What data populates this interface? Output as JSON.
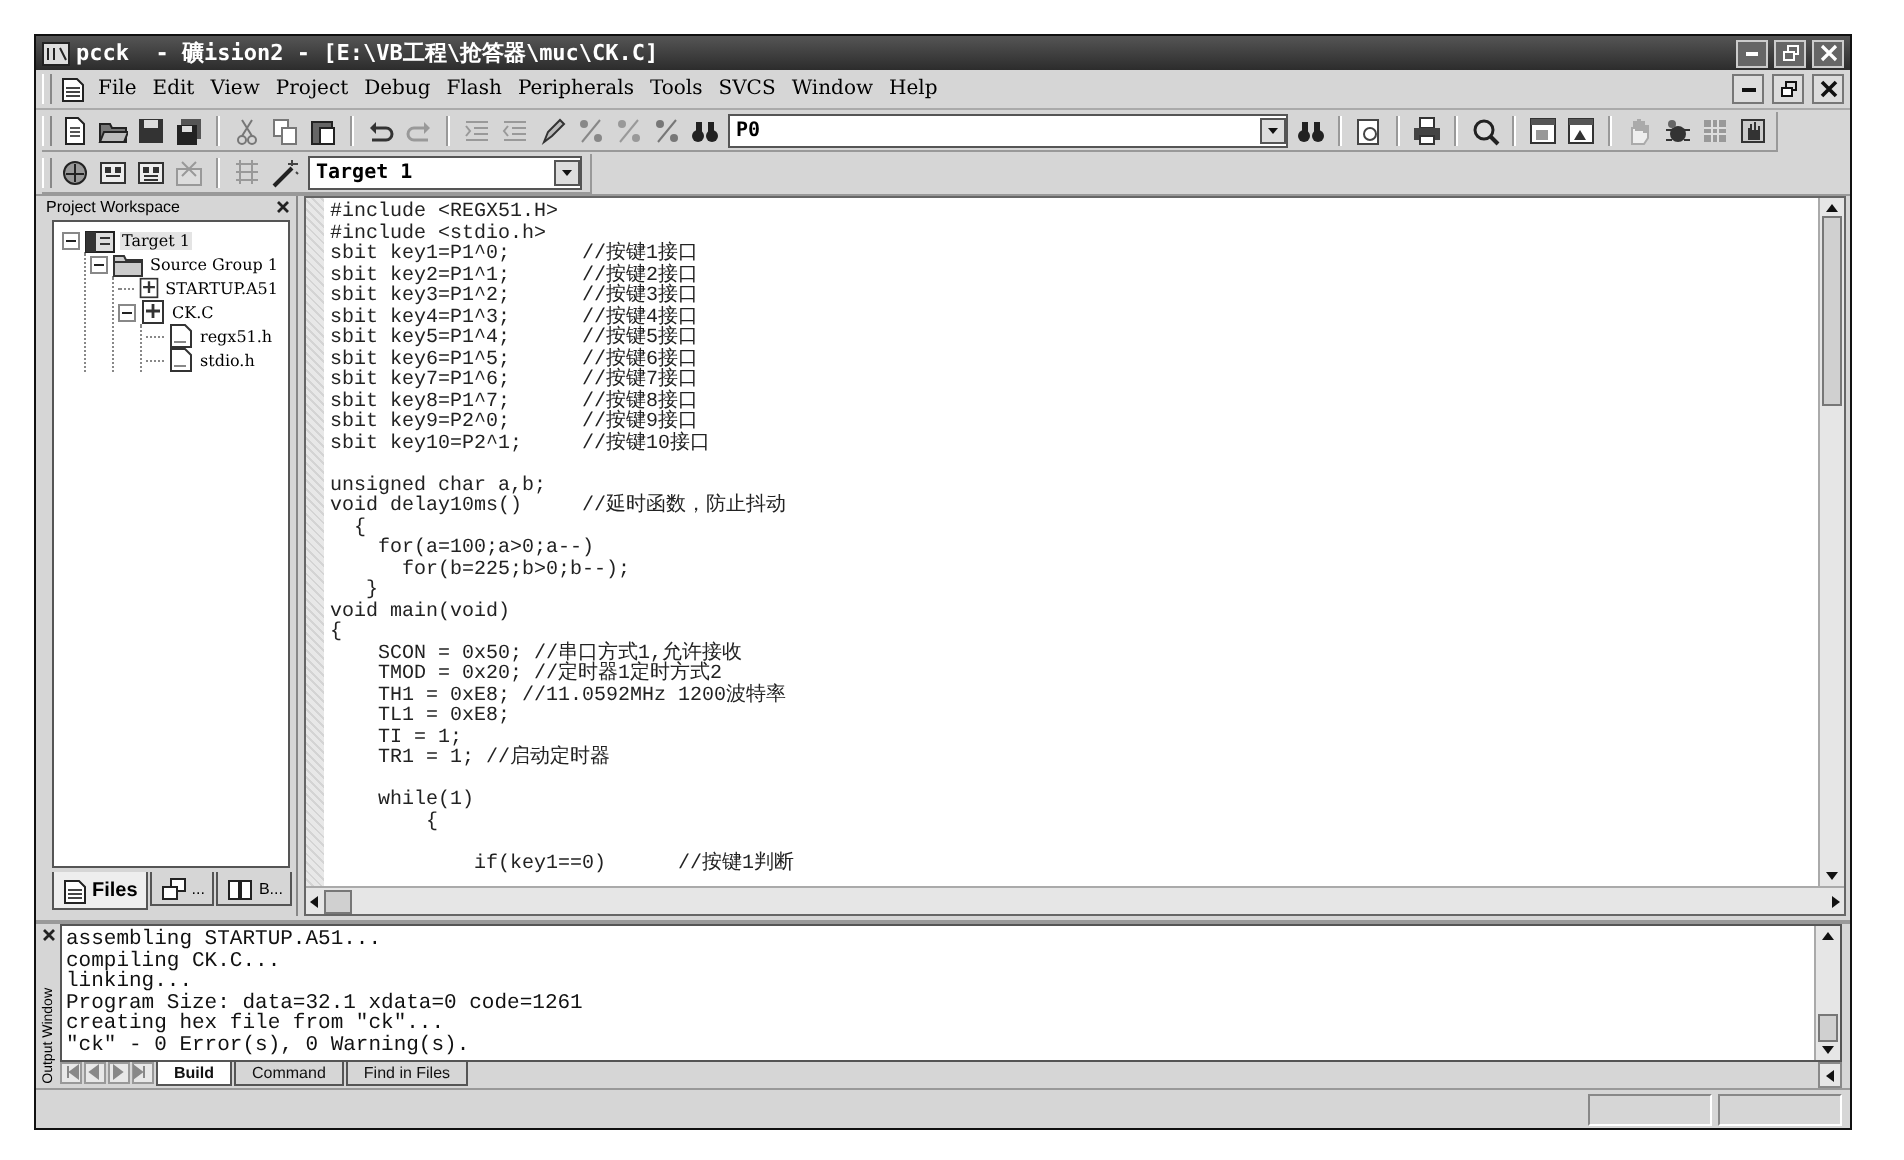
{
  "window": {
    "title": "pcck  - 礦ision2 - [E:\\VB工程\\抢答器\\muc\\CK.C]"
  },
  "menu": [
    "File",
    "Edit",
    "View",
    "Project",
    "Debug",
    "Flash",
    "Peripherals",
    "Tools",
    "SVCS",
    "Window",
    "Help"
  ],
  "toolbar": {
    "find_combo": {
      "value": "P0"
    }
  },
  "build_toolbar": {
    "target_combo": {
      "value": "Target 1"
    }
  },
  "project_workspace": {
    "title": "Project Workspace",
    "tree": [
      {
        "label": "Target 1",
        "kind": "target",
        "expanded": true,
        "children": [
          {
            "label": "Source Group 1",
            "kind": "group",
            "expanded": true,
            "children": [
              {
                "label": "STARTUP.A51",
                "kind": "source"
              },
              {
                "label": "CK.C",
                "kind": "source",
                "expanded": true,
                "children": [
                  {
                    "label": "regx51.h",
                    "kind": "header"
                  },
                  {
                    "label": "stdio.h",
                    "kind": "header"
                  }
                ]
              }
            ]
          }
        ]
      }
    ],
    "tabs": [
      {
        "label": "Files",
        "selected": true
      },
      {
        "label": "...",
        "selected": false
      },
      {
        "label": "B...",
        "selected": false
      }
    ]
  },
  "editor": {
    "blocks": [
      [
        "#include <REGX51.H>",
        "#include <stdio.h>",
        "sbit key1=P1^0;      //按键1接口",
        "sbit key2=P1^1;      //按键2接口",
        "sbit key3=P1^2;      //按键3接口",
        "sbit key4=P1^3;      //按键4接口",
        "sbit key5=P1^4;      //按键5接口",
        "sbit key6=P1^5;      //按键6接口",
        "sbit key7=P1^6;      //按键7接口",
        "sbit key8=P1^7;      //按键8接口",
        "sbit key9=P2^0;      //按键9接口",
        "sbit key10=P2^1;     //按键10接口"
      ],
      [
        "unsigned char a,b;",
        "void delay10ms()     //延时函数，防止抖动",
        "  {",
        "    for(a=100;a>0;a--)",
        "      for(b=225;b>0;b--);",
        "   }",
        "void main(void)",
        "{",
        "    SCON = 0x50; //串口方式1,允许接收",
        "    TMOD = 0x20; //定时器1定时方式2",
        "    TH1 = 0xE8; //11.0592MHz 1200波特率",
        "    TL1 = 0xE8;",
        "    TI = 1;",
        "    TR1 = 1; //启动定时器"
      ],
      [
        "    while(1)",
        "        {"
      ],
      [
        "            if(key1==0)      //按键1判断"
      ]
    ]
  },
  "output_window": {
    "title": "Output Window",
    "lines": [
      "assembling STARTUP.A51...",
      "compiling CK.C...",
      "linking...",
      "Program Size: data=32.1 xdata=0 code=1261",
      "creating hex file from \"ck\"...",
      "\"ck\" - 0 Error(s), 0 Warning(s)."
    ],
    "tabs": [
      {
        "label": "Build",
        "selected": true
      },
      {
        "label": "Command",
        "selected": false
      },
      {
        "label": "Find in Files",
        "selected": false
      }
    ]
  }
}
